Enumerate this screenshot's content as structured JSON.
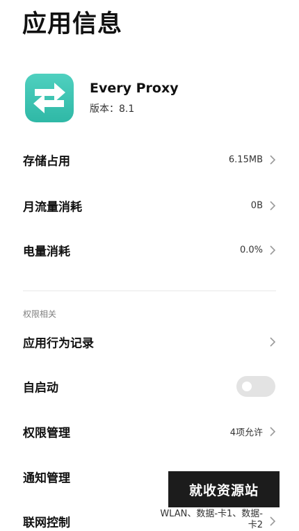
{
  "page": {
    "title": "应用信息"
  },
  "app": {
    "name": "Every Proxy",
    "version": "版本：8.1"
  },
  "usage_rows": [
    {
      "label": "存储占用",
      "value": "6.15MB"
    },
    {
      "label": "月流量消耗",
      "value": "0B"
    },
    {
      "label": "电量消耗",
      "value": "0.0%"
    }
  ],
  "permissions_section": {
    "title": "权限相关",
    "behavior_record": {
      "label": "应用行为记录"
    },
    "autostart": {
      "label": "自启动",
      "enabled": false
    },
    "permission_manage": {
      "label": "权限管理",
      "value": "4项允许"
    },
    "notification_manage": {
      "label": "通知管理"
    },
    "network_control": {
      "label": "联网控制",
      "value": "WLAN、数据-卡1、数据-卡2"
    }
  },
  "watermark": {
    "text": "就收资源站"
  },
  "colors": {
    "icon_teal": "#3cc3b1",
    "toggle_off": "#e3e3e3",
    "section_title": "#808080"
  }
}
